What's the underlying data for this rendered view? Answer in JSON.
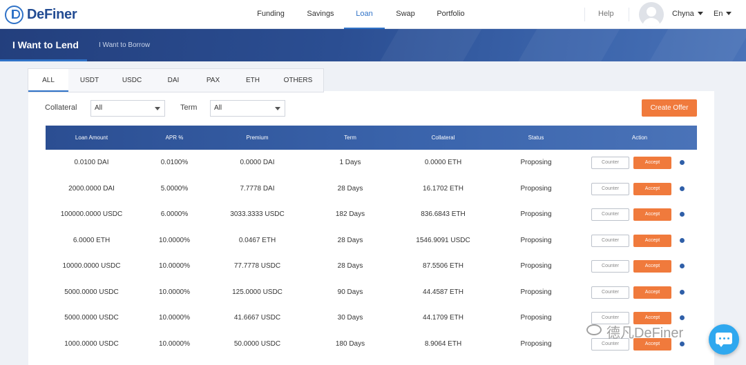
{
  "app": {
    "logo_text": "DeFiner"
  },
  "nav": {
    "items": [
      {
        "label": "Funding"
      },
      {
        "label": "Savings"
      },
      {
        "label": "Loan",
        "active": true
      },
      {
        "label": "Swap"
      },
      {
        "label": "Portfolio"
      }
    ],
    "help": "Help",
    "user_name": "Chyna",
    "language": "En"
  },
  "banner": {
    "tab_lend": "I Want to Lend",
    "tab_borrow": "I Want to Borrow"
  },
  "asset_tabs": [
    "ALL",
    "USDT",
    "USDC",
    "DAI",
    "PAX",
    "ETH",
    "OTHERS"
  ],
  "filters": {
    "collateral_label": "Collateral",
    "collateral_value": "All",
    "term_label": "Term",
    "term_value": "All",
    "create_offer": "Create Offer"
  },
  "table": {
    "headers": [
      "Loan Amount",
      "APR %",
      "Premium",
      "Term",
      "Collateral",
      "Status",
      "Action"
    ],
    "counter_label": "Counter",
    "accept_label": "Accept",
    "rows": [
      {
        "loan_amount": "0.0100 DAI",
        "apr": "0.0100%",
        "premium": "0.0000 DAI",
        "term": "1 Days",
        "collateral": "0.0000 ETH",
        "status": "Proposing"
      },
      {
        "loan_amount": "2000.0000 DAI",
        "apr": "5.0000%",
        "premium": "7.7778 DAI",
        "term": "28 Days",
        "collateral": "16.1702 ETH",
        "status": "Proposing"
      },
      {
        "loan_amount": "100000.0000 USDC",
        "apr": "6.0000%",
        "premium": "3033.3333 USDC",
        "term": "182 Days",
        "collateral": "836.6843 ETH",
        "status": "Proposing"
      },
      {
        "loan_amount": "6.0000 ETH",
        "apr": "10.0000%",
        "premium": "0.0467 ETH",
        "term": "28 Days",
        "collateral": "1546.9091 USDC",
        "status": "Proposing"
      },
      {
        "loan_amount": "10000.0000 USDC",
        "apr": "10.0000%",
        "premium": "77.7778 USDC",
        "term": "28 Days",
        "collateral": "87.5506 ETH",
        "status": "Proposing"
      },
      {
        "loan_amount": "5000.0000 USDC",
        "apr": "10.0000%",
        "premium": "125.0000 USDC",
        "term": "90 Days",
        "collateral": "44.4587 ETH",
        "status": "Proposing"
      },
      {
        "loan_amount": "5000.0000 USDC",
        "apr": "10.0000%",
        "premium": "41.6667 USDC",
        "term": "30 Days",
        "collateral": "44.1709 ETH",
        "status": "Proposing"
      },
      {
        "loan_amount": "1000.0000 USDC",
        "apr": "10.0000%",
        "premium": "50.0000 USDC",
        "term": "180 Days",
        "collateral": "8.9064 ETH",
        "status": "Proposing"
      }
    ]
  },
  "watermark": {
    "text": "德凡DeFiner"
  },
  "colors": {
    "brand_blue": "#2f72c7",
    "banner_navy": "#2b4e92",
    "accent_orange": "#f07a3c"
  }
}
